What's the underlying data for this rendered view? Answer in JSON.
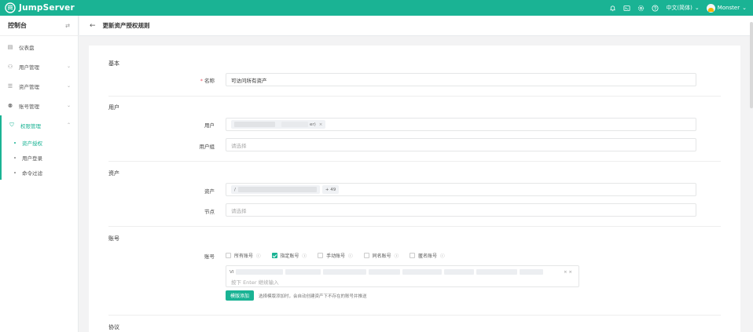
{
  "app": {
    "name": "JumpServer"
  },
  "topbar": {
    "language": "中文(简体)",
    "username": "Monster",
    "icons": [
      "bell-icon",
      "terminal-icon",
      "gear-icon",
      "help-icon"
    ]
  },
  "sidebar": {
    "title": "控制台",
    "toggle_glyph": "⇄",
    "items": [
      {
        "label": "仪表盘",
        "icon": "dashboard-icon",
        "glyph": "▤"
      },
      {
        "label": "用户管理",
        "icon": "users-icon",
        "glyph": "⚇",
        "chev": "⌄"
      },
      {
        "label": "资产管理",
        "icon": "assets-icon",
        "glyph": "☰",
        "chev": "⌄"
      },
      {
        "label": "账号管理",
        "icon": "accounts-icon",
        "glyph": "⚉",
        "chev": "⌄"
      },
      {
        "label": "权限管理",
        "icon": "shield-icon",
        "glyph": "⛉",
        "chev": "⌃"
      }
    ],
    "sub_items": [
      {
        "label": "资产授权"
      },
      {
        "label": "用户登录"
      },
      {
        "label": "命令过滤"
      }
    ]
  },
  "page": {
    "title": "更新资产授权规则",
    "back_glyph": "←"
  },
  "form": {
    "basic": {
      "title": "基本",
      "name_label": "名称",
      "name_value": "可访问所有资产"
    },
    "users": {
      "title": "用户",
      "user_label": "用户",
      "user_tag_suffix": "er)",
      "group_label": "用户组",
      "group_placeholder": "请选择"
    },
    "assets": {
      "title": "资产",
      "asset_label": "资产",
      "asset_tag_prefix": "/",
      "asset_more": "+ 49",
      "node_label": "节点",
      "node_placeholder": "请选择"
    },
    "accounts": {
      "title": "账号",
      "label": "账号",
      "options": [
        {
          "label": "所有账号",
          "checked": false
        },
        {
          "label": "指定账号",
          "checked": true
        },
        {
          "label": "手动账号",
          "checked": false
        },
        {
          "label": "同名账号",
          "checked": false
        },
        {
          "label": "匿名账号",
          "checked": false
        }
      ],
      "first_tag_prefix": "VI",
      "input_placeholder": "按下 Enter 继续输入",
      "template_button": "模版添加",
      "template_tip": "选择模版添加时，会自动创建资产下不存在的账号并推送"
    },
    "protocol": {
      "title": "协议"
    }
  }
}
